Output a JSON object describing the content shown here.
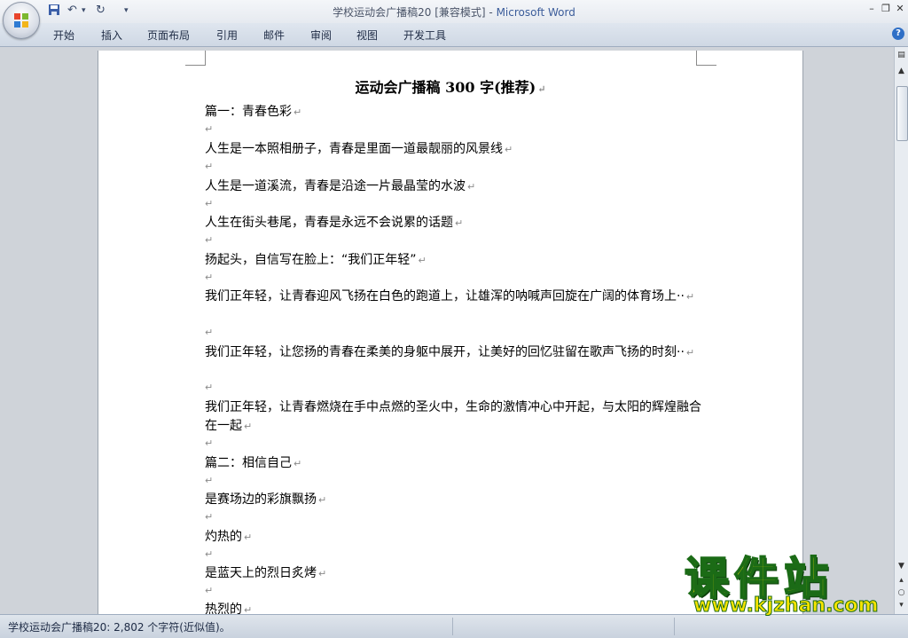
{
  "window": {
    "title_doc": "学校运动会广播稿20 [兼容模式] - ",
    "title_app": "Microsoft Word"
  },
  "ribbon": {
    "tabs": [
      "开始",
      "插入",
      "页面布局",
      "引用",
      "邮件",
      "审阅",
      "视图",
      "开发工具"
    ],
    "help_label": "?"
  },
  "document": {
    "title": "运动会广播稿 300 字(推荐)",
    "paragraphs": [
      "篇一：青春色彩",
      "人生是一本照相册子，青春是里面一道最靓丽的风景线",
      "人生是一道溪流，青春是沿途一片最晶莹的水波",
      "人生在街头巷尾，青春是永远不会说累的话题",
      "扬起头，自信写在脸上：“我们正年轻”",
      "我们正年轻，让青春迎风飞扬在白色的跑道上，让雄浑的呐喊声回旋在广阔的体育场上··",
      "我们正年轻，让您扬的青春在柔美的身躯中展开，让美好的回忆驻留在歌声飞扬的时刻··",
      "我们正年轻，让青春燃烧在手中点燃的圣火中，生命的激情冲心中开起，与太阳的辉煌融合在一起",
      "篇二：相信自己",
      "是赛场边的彩旗飘扬",
      "灼热的",
      "是蓝天上的烈日炙烤",
      "热烈的"
    ],
    "paragraph_mark": "↵"
  },
  "statusbar": {
    "text": "学校运动会广播稿20: 2,802 个字符(近似值)。"
  },
  "watermark": {
    "brand": "课件站",
    "url": "www.kjzhan.com"
  }
}
